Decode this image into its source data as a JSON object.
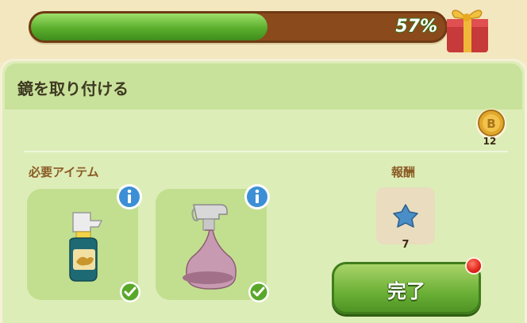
{
  "progress": {
    "percent_label": "57%",
    "value": 0.57
  },
  "header": {
    "title": "鏡を取り付ける"
  },
  "coin": {
    "count": "12",
    "icon": "coin-b-icon"
  },
  "required": {
    "label": "必要アイテム",
    "items": [
      {
        "name": "glass-cleaner-bottle-icon",
        "info_icon": "info-icon",
        "status_icon": "check-icon"
      },
      {
        "name": "spray-bottle-icon",
        "info_icon": "info-icon",
        "status_icon": "check-icon"
      }
    ]
  },
  "reward": {
    "label": "報酬",
    "icon": "blue-star-icon",
    "count": "7"
  },
  "complete_button": {
    "label": "完了"
  },
  "colors": {
    "progress_fill": "#5aae2c",
    "progress_track": "#8b4a1c",
    "panel": "#ddedb8",
    "button": "#6bb036",
    "notification": "#e0231a"
  }
}
